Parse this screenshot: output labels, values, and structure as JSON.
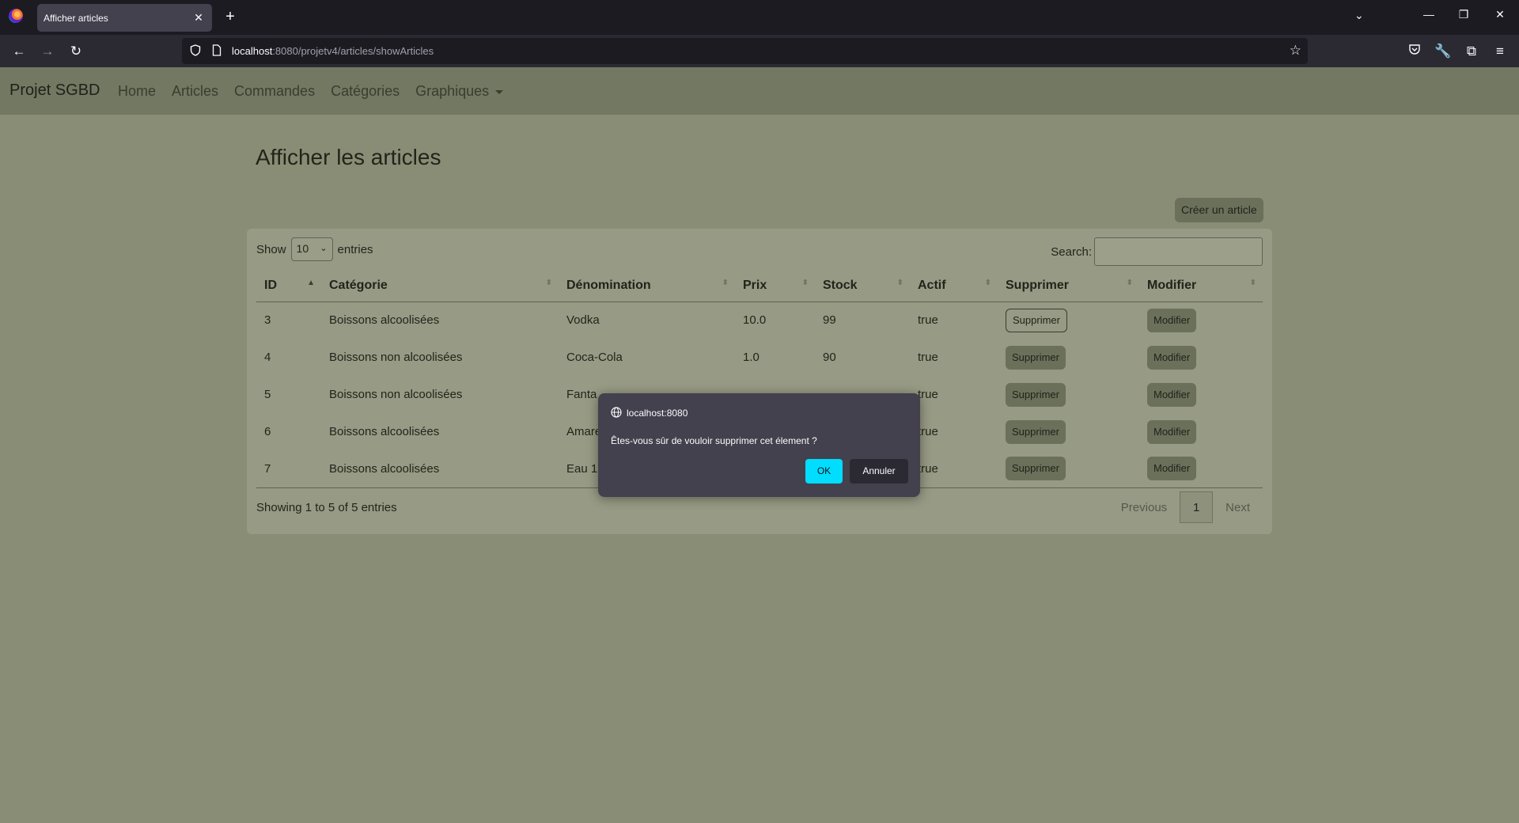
{
  "browser": {
    "tab_title": "Afficher articles",
    "url_host": "localhost",
    "url_rest": ":8080/projetv4/articles/showArticles"
  },
  "app": {
    "brand": "Projet SGBD",
    "nav": [
      "Home",
      "Articles",
      "Commandes",
      "Catégories",
      "Graphiques"
    ]
  },
  "page": {
    "title": "Afficher les articles",
    "create_button": "Créer un article"
  },
  "table_controls": {
    "show_label": "Show",
    "page_size": "10",
    "entries_label": "entries",
    "search_label": "Search:",
    "search_value": ""
  },
  "table": {
    "columns": [
      "ID",
      "Catégorie",
      "Dénomination",
      "Prix",
      "Stock",
      "Actif",
      "Supprimer",
      "Modifier"
    ],
    "rows": [
      {
        "id": "3",
        "categorie": "Boissons alcoolisées",
        "denomination": "Vodka",
        "prix": "10.0",
        "stock": "99",
        "actif": "true",
        "supprimer": "Supprimer",
        "modifier": "Modifier"
      },
      {
        "id": "4",
        "categorie": "Boissons non alcoolisées",
        "denomination": "Coca-Cola",
        "prix": "1.0",
        "stock": "90",
        "actif": "true",
        "supprimer": "Supprimer",
        "modifier": "Modifier"
      },
      {
        "id": "5",
        "categorie": "Boissons non alcoolisées",
        "denomination": "Fanta",
        "prix": "",
        "stock": "",
        "actif": "true",
        "supprimer": "Supprimer",
        "modifier": "Modifier"
      },
      {
        "id": "6",
        "categorie": "Boissons alcoolisées",
        "denomination": "Amare",
        "prix": "",
        "stock": "",
        "actif": "true",
        "supprimer": "Supprimer",
        "modifier": "Modifier"
      },
      {
        "id": "7",
        "categorie": "Boissons alcoolisées",
        "denomination": "Eau 1",
        "prix": "",
        "stock": "",
        "actif": "true",
        "supprimer": "Supprimer",
        "modifier": "Modifier"
      }
    ]
  },
  "footer": {
    "info": "Showing 1 to 5 of 5 entries",
    "previous": "Previous",
    "current_page": "1",
    "next": "Next"
  },
  "dialog": {
    "host": "localhost:8080",
    "message": "Êtes-vous sûr de vouloir supprimer cet élement ?",
    "ok": "OK",
    "cancel": "Annuler"
  },
  "colors": {
    "page_bg": "#8a8d75",
    "ok_button": "#00ddff"
  }
}
